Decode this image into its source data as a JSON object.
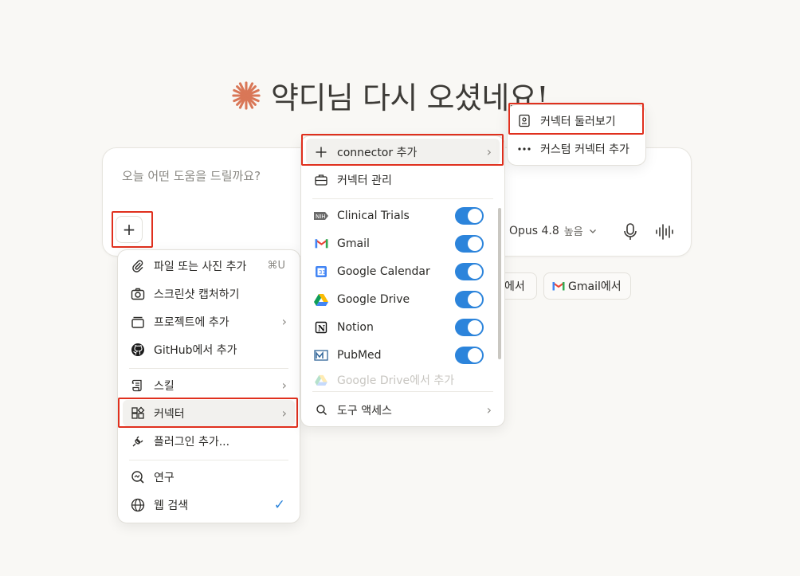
{
  "greeting": {
    "text": "약디님 다시 오셨네요!"
  },
  "composer": {
    "placeholder": "오늘 어떤 도움을 드릴까요?",
    "plus": "+",
    "model_name": "Opus 4.8",
    "effort": "높음"
  },
  "chips": [
    {
      "label": "에서"
    },
    {
      "label": "Gmail에서"
    }
  ],
  "main_menu": {
    "items": [
      {
        "label": "파일 또는 사진 추가",
        "shortcut": "⌘U"
      },
      {
        "label": "스크린샷 캡처하기"
      },
      {
        "label": "프로젝트에 추가",
        "chevron": "›"
      },
      {
        "label": "GitHub에서 추가"
      },
      {
        "label": "스킬",
        "chevron": "›"
      },
      {
        "label": "커넥터",
        "chevron": "›"
      },
      {
        "label": "플러그인 추가..."
      },
      {
        "label": "연구"
      },
      {
        "label": "웹 검색",
        "check": "✓"
      }
    ]
  },
  "connector_menu": {
    "add_label": "connector 추가",
    "manage_label": "커넥터 관리",
    "connectors": [
      {
        "name": "Clinical Trials",
        "enabled": true
      },
      {
        "name": "Gmail",
        "enabled": true
      },
      {
        "name": "Google Calendar",
        "enabled": true
      },
      {
        "name": "Google Drive",
        "enabled": true
      },
      {
        "name": "Notion",
        "enabled": true
      },
      {
        "name": "PubMed",
        "enabled": true
      }
    ],
    "faded_item": "Google Drive에서 추가",
    "tool_access": "도구 액세스",
    "chevron": "›"
  },
  "sub_menu": {
    "browse_label": "커넥터 둘러보기",
    "custom_label": "커스텀 커넥터 추가"
  },
  "colors": {
    "accent_orange": "#d97757",
    "toggle_blue": "#2c84db",
    "highlight_red": "#e0301e"
  }
}
